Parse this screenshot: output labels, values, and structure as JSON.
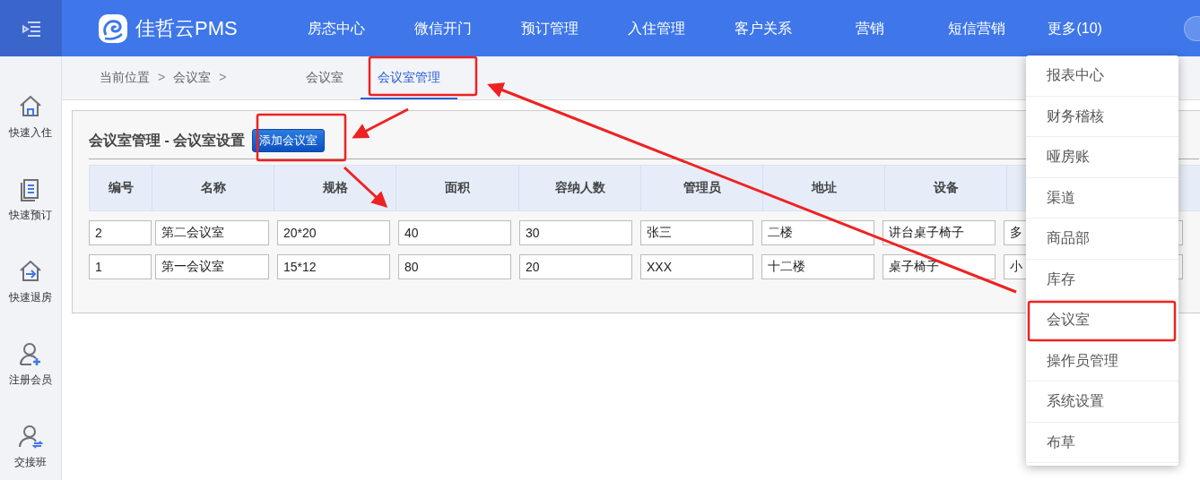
{
  "header": {
    "brand": "佳哲云PMS",
    "nav": [
      "房态中心",
      "微信开门",
      "预订管理",
      "入住管理",
      "客户关系",
      "营销",
      "短信营销",
      "更多(10)"
    ]
  },
  "sidebar": {
    "items": [
      {
        "kind": "checkin",
        "label": "快速入住"
      },
      {
        "kind": "booking",
        "label": "快速预订"
      },
      {
        "kind": "checkout",
        "label": "快速退房"
      },
      {
        "kind": "register",
        "label": "注册会员"
      },
      {
        "kind": "handover",
        "label": "交接班"
      }
    ]
  },
  "breadcrumb": [
    "当前位置",
    ">",
    "会议室",
    ">"
  ],
  "tabs": [
    {
      "label": "会议室",
      "selected": false
    },
    {
      "label": "会议室管理",
      "selected": true
    }
  ],
  "panel": {
    "title": "会议室管理 - 会议室设置",
    "add_button": "添加会议室"
  },
  "table": {
    "columns": [
      "编号",
      "名称",
      "规格",
      "面积",
      "容纳人数",
      "管理员",
      "地址",
      "设备"
    ],
    "rows": [
      [
        "2",
        "第二会议室",
        "20*20",
        "40",
        "30",
        "张三",
        "二楼",
        "讲台桌子椅子",
        "多"
      ],
      [
        "1",
        "第一会议室",
        "15*12",
        "80",
        "20",
        "XXX",
        "十二楼",
        "桌子椅子",
        "小"
      ]
    ]
  },
  "more_menu": {
    "items": [
      "报表中心",
      "财务稽核",
      "哑房账",
      "渠道",
      "商品部",
      "库存",
      "会议室",
      "操作员管理",
      "系统设置",
      "布草"
    ]
  }
}
